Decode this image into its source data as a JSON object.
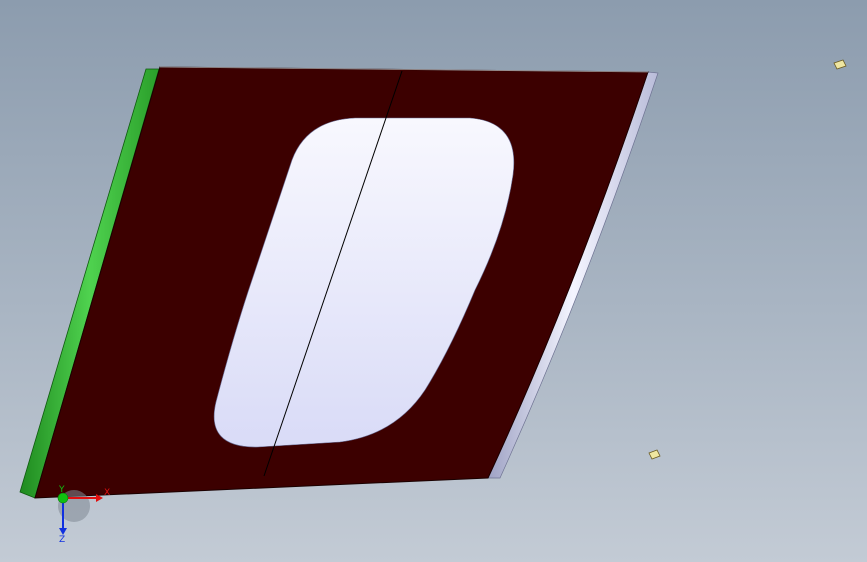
{
  "viewport": {
    "background_top": "#8c9cae",
    "background_bottom": "#c3cbd5"
  },
  "model": {
    "panel_color": "#3c0000",
    "cutout_color": "#eceefc",
    "left_edge_color": "#3dba3d",
    "right_edge_color": "#d8dbf0",
    "markers_color": "#e6dc8c"
  },
  "triad": {
    "x_label": "X",
    "y_label": "Y",
    "z_label": "Z",
    "x_color": "#e01010",
    "y_color": "#10c010",
    "z_color": "#1030e0"
  }
}
